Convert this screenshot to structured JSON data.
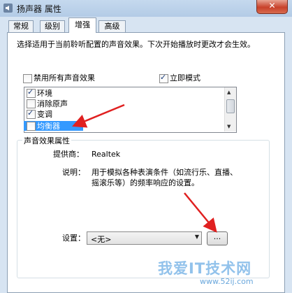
{
  "window": {
    "title": "扬声器 属性",
    "close_label": "✕"
  },
  "tabs": [
    {
      "label": "常规",
      "active": false
    },
    {
      "label": "级别",
      "active": false
    },
    {
      "label": "增强",
      "active": true
    },
    {
      "label": "高级",
      "active": false
    }
  ],
  "description": "选择适用于当前聆听配置的声音效果。下次开始播放时更改才会生效。",
  "disable_all": {
    "label": "禁用所有声音效果",
    "checked": false
  },
  "immediate": {
    "label": "立即模式",
    "checked": true
  },
  "effects": [
    {
      "label": "环境",
      "checked": true
    },
    {
      "label": "消除原声",
      "checked": false
    },
    {
      "label": "变调",
      "checked": true
    },
    {
      "label": "均衡器",
      "checked": false,
      "selected": true
    }
  ],
  "properties": {
    "title": "声音效果属性",
    "provider_label": "提供商：",
    "provider_value": "Realtek",
    "desc_label": "说明：",
    "desc_line1": "用于模拟各种表演条件（如流行乐、直播、",
    "desc_line2": "摇滚乐等）的频率响应的设置。",
    "settings_label": "设置：",
    "settings_value": "<无>",
    "settings_button": "..."
  },
  "watermark": {
    "text": "我爱IT技术网",
    "url": "www.52ij.com"
  },
  "colors": {
    "selection": "#3399ff",
    "arrow": "#e02020",
    "accent": "#1a3b7a"
  }
}
